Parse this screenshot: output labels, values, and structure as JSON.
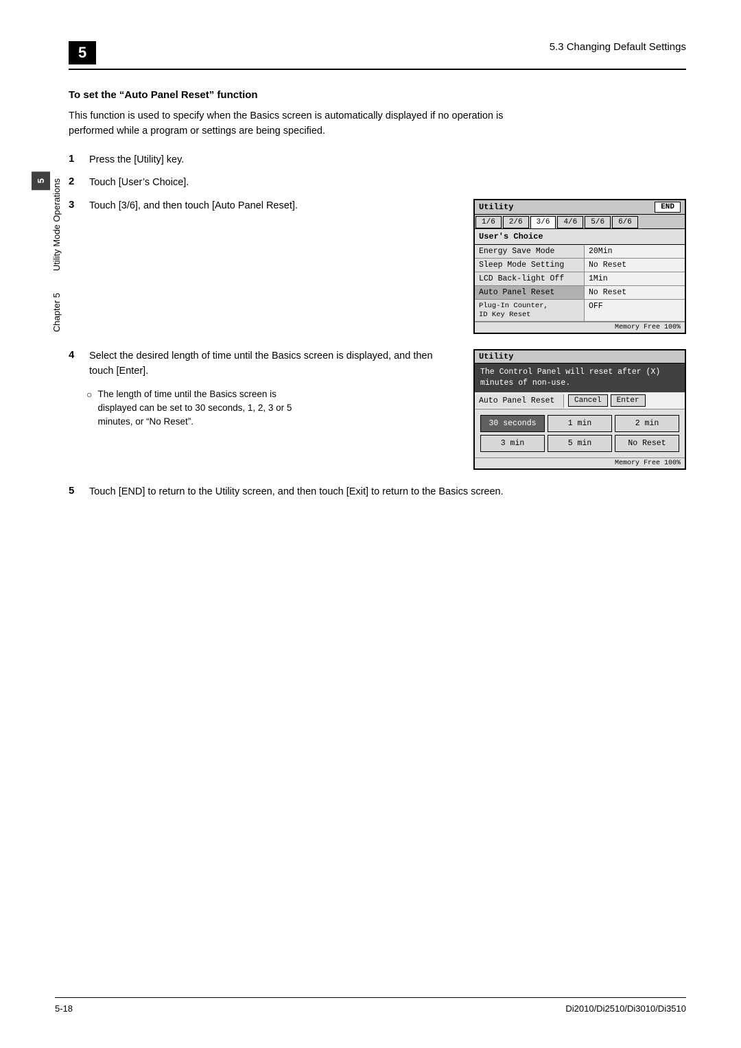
{
  "header": {
    "chapter_label": "5",
    "title": "5.3 Changing Default Settings"
  },
  "section": {
    "heading": "To set the “Auto Panel Reset” function",
    "intro": "This function is used to specify when the Basics screen is automatically displayed if no operation is performed while a program or settings are being specified."
  },
  "steps": [
    {
      "num": "1",
      "text": "Press the [Utility] key."
    },
    {
      "num": "2",
      "text": "Touch [User’s Choice]."
    },
    {
      "num": "3",
      "text": "Touch [3/6], and then touch [Auto Panel Reset]."
    },
    {
      "num": "4",
      "text": "Select the desired length of time until the Basics screen is displayed, and then touch [Enter].",
      "sub": "The length of time until the Basics screen is displayed can be set to 30 seconds, 1, 2, 3 or 5 minutes, or “No Reset”."
    },
    {
      "num": "5",
      "text": "Touch [END] to return to the Utility screen, and then touch [Exit] to return to the Basics screen."
    }
  ],
  "screen1": {
    "title": "Utility",
    "end_btn": "END",
    "tabs": [
      "1/6",
      "2/6",
      "3/6",
      "4/6",
      "5/6",
      "6/6"
    ],
    "active_tab": "3/6",
    "label": "User's Choice",
    "rows": [
      {
        "key": "Energy Save Mode",
        "val": "20Min"
      },
      {
        "key": "Sleep Mode Setting",
        "val": "No Reset"
      },
      {
        "key": "LCD Back-light Off",
        "val": "1Min"
      },
      {
        "key": "Auto Panel Reset",
        "val": "No Reset"
      },
      {
        "key": "Plug-In Counter,\nID Key Reset",
        "val": "OFF"
      }
    ],
    "memory": "Memory Free 100%"
  },
  "screen2": {
    "title": "Utility",
    "info_line1": "The Control Panel will reset after (X)",
    "info_line2": "minutes of non-use.",
    "row_label": "Auto Panel Reset",
    "cancel_btn": "Cancel",
    "enter_btn": "Enter",
    "options": [
      {
        "label": "30 seconds",
        "selected": true
      },
      {
        "label": "1 min",
        "selected": false
      },
      {
        "label": "2 min",
        "selected": false
      },
      {
        "label": "3 min",
        "selected": false
      },
      {
        "label": "5 min",
        "selected": false
      },
      {
        "label": "No Reset",
        "selected": false
      }
    ],
    "memory": "Memory Free 100%"
  },
  "sidebar": {
    "chapter_num": "5",
    "label": "Utility Mode Operations"
  },
  "footer": {
    "left": "5-18",
    "right": "Di2010/Di2510/Di3010/Di3510"
  }
}
